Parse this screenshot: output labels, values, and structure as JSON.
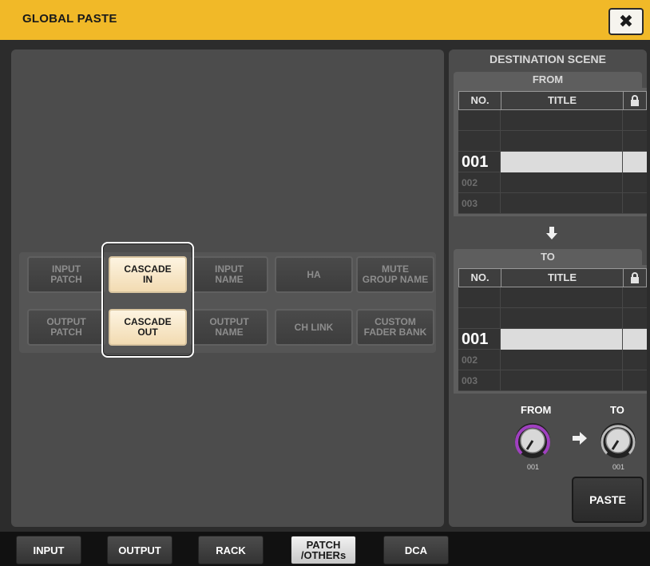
{
  "title_bar": {
    "title": "GLOBAL PASTE",
    "close_label": "✖",
    "color": "#f1b928"
  },
  "items": {
    "row1": [
      {
        "label": "INPUT\nPATCH",
        "on": false
      },
      {
        "label": "CASCADE\nIN",
        "on": true
      },
      {
        "label": "INPUT\nNAME",
        "on": false
      },
      {
        "label": "HA",
        "on": false
      },
      {
        "label": "MUTE\nGROUP NAME",
        "on": false
      }
    ],
    "row2": [
      {
        "label": "OUTPUT\nPATCH",
        "on": false
      },
      {
        "label": "CASCADE\nOUT",
        "on": true
      },
      {
        "label": "OUTPUT\nNAME",
        "on": false
      },
      {
        "label": "CH LINK",
        "on": false
      },
      {
        "label": "CUSTOM\nFADER BANK",
        "on": false
      }
    ]
  },
  "destination": {
    "header": "DESTINATION SCENE",
    "from_label": "FROM",
    "to_label": "TO",
    "col_no": "NO.",
    "col_title": "TITLE",
    "lock_icon": "lock-icon",
    "from_rows": [
      "",
      "",
      "001",
      "002",
      "003"
    ],
    "to_rows": [
      "",
      "",
      "001",
      "002",
      "003"
    ],
    "knob_from_label": "FROM",
    "knob_to_label": "TO",
    "knob_from_value": "001",
    "knob_to_value": "001",
    "paste_label": "PASTE"
  },
  "tabs": [
    {
      "label": "INPUT",
      "active": false
    },
    {
      "label": "OUTPUT",
      "active": false
    },
    {
      "label": "RACK",
      "active": false
    },
    {
      "label": "PATCH\n/OTHERs",
      "active": true
    },
    {
      "label": "DCA",
      "active": false
    }
  ],
  "colors": {
    "accent": "#f1b928",
    "knob_ring": "#a040c0",
    "button_on": "#f6e4c0"
  }
}
